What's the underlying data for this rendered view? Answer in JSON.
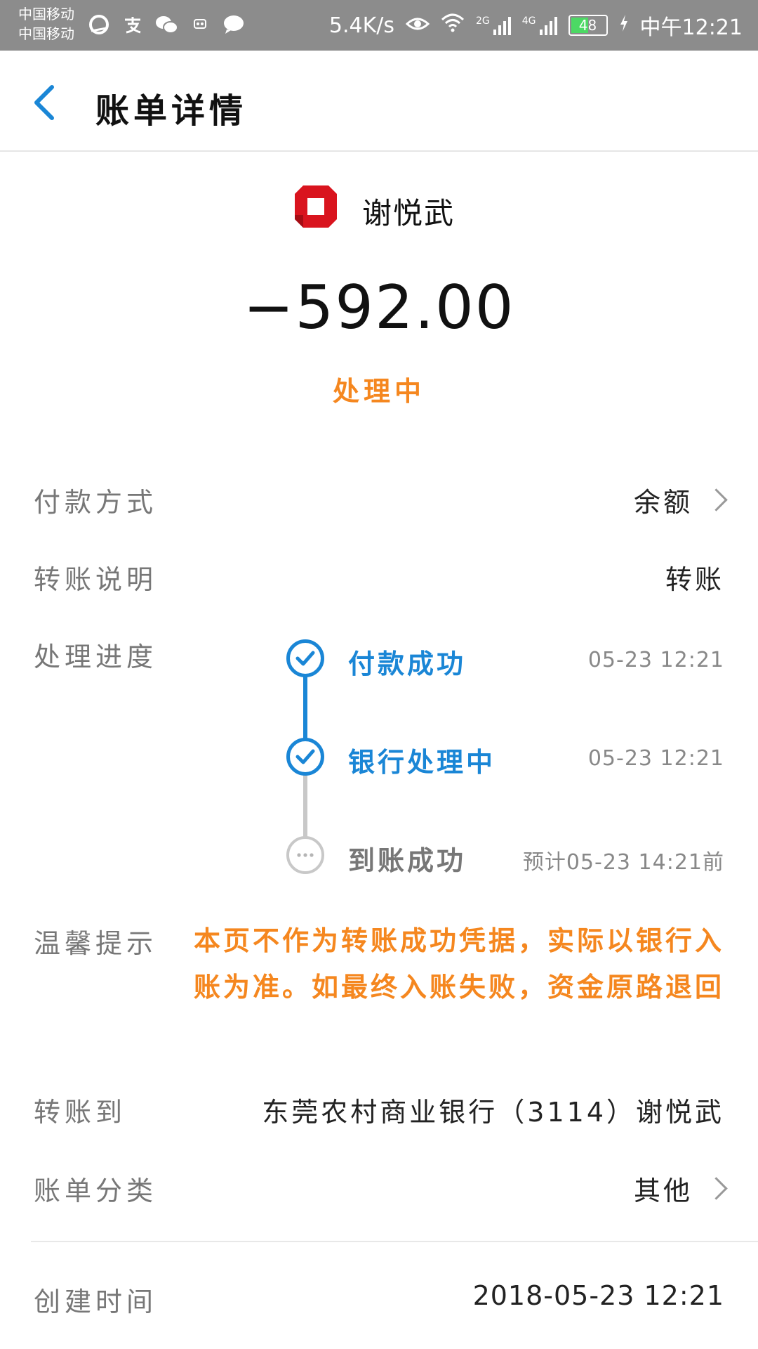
{
  "status_bar": {
    "carrier_1": "中国移动",
    "carrier_2": "中国移动",
    "speed": "5.4K/s",
    "net_2g": "2G",
    "net_4g": "4G",
    "battery": "48",
    "time": "中午12:21"
  },
  "header": {
    "title": "账单详情"
  },
  "payee": {
    "name": "谢悦武"
  },
  "amount": "−592.00",
  "status": "处理中",
  "rows": {
    "payment_method": {
      "label": "付款方式",
      "value": "余额"
    },
    "transfer_note": {
      "label": "转账说明",
      "value": "转账"
    },
    "progress_label": "处理进度",
    "tip": {
      "label": "温馨提示",
      "text": "本页不作为转账成功凭据，实际以银行入账为准。如最终入账失败，资金原路退回"
    },
    "transfer_to": {
      "label": "转账到",
      "value": "东莞农村商业银行（3114）谢悦武"
    },
    "category": {
      "label": "账单分类",
      "value": "其他"
    },
    "created": {
      "label": "创建时间",
      "value": "2018-05-23 12:21"
    }
  },
  "timeline": [
    {
      "step": "付款成功",
      "time": "05-23 12:21",
      "state": "done"
    },
    {
      "step": "银行处理中",
      "time": "05-23 12:21",
      "state": "done"
    },
    {
      "step": "到账成功",
      "time": "预计05-23 14:21前",
      "state": "pending"
    }
  ],
  "colors": {
    "accent_blue": "#1a86d6",
    "status_orange": "#f5871f",
    "status_bar": "#8c8c8c",
    "bank_red": "#d9141e"
  }
}
